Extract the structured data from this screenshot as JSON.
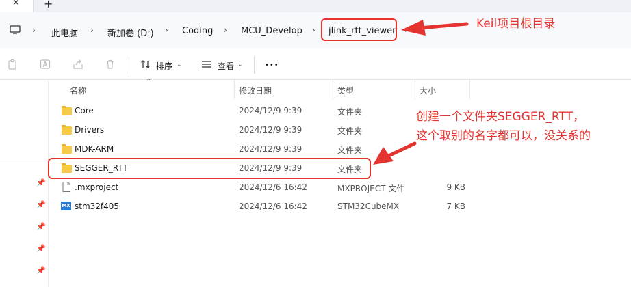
{
  "tabs": {
    "close_glyph": "✕",
    "new_glyph": "+"
  },
  "breadcrumb": {
    "items": [
      "此电脑",
      "新加卷 (D:)",
      "Coding",
      "MCU_Develop",
      "jlink_rtt_viewer"
    ],
    "separator": "›"
  },
  "toolbar": {
    "sort_label": "排序",
    "view_label": "查看",
    "more_label": "•••"
  },
  "columns": {
    "name": "名称",
    "date": "修改日期",
    "type": "类型",
    "size": "大小"
  },
  "files": [
    {
      "name": "Core",
      "date": "2024/12/9 9:39",
      "type": "文件夹",
      "size": "",
      "icon": "folder-icon"
    },
    {
      "name": "Drivers",
      "date": "2024/12/9 9:39",
      "type": "文件夹",
      "size": "",
      "icon": "folder-icon"
    },
    {
      "name": "MDK-ARM",
      "date": "2024/12/9 9:39",
      "type": "文件夹",
      "size": "",
      "icon": "folder-icon"
    },
    {
      "name": "SEGGER_RTT",
      "date": "2024/12/9 9:39",
      "type": "文件夹",
      "size": "",
      "icon": "folder-icon"
    },
    {
      "name": ".mxproject",
      "date": "2024/12/6 16:42",
      "type": "MXPROJECT 文件",
      "size": "9 KB",
      "icon": "file-icon"
    },
    {
      "name": "stm32f405",
      "date": "2024/12/6 16:42",
      "type": "STM32CubeMX",
      "size": "7 KB",
      "icon": "mx-icon"
    }
  ],
  "mx_icon_text": "MX",
  "annotations": {
    "root_dir": "Keil项目根目录",
    "folder_line1": "创建一个文件夹SEGGER_RTT，",
    "folder_line2": "这个取别的名字都可以，没关系的"
  },
  "colors": {
    "annotation": "#e3342f",
    "folder": "#f7c948",
    "mx": "#2b7bd6"
  }
}
